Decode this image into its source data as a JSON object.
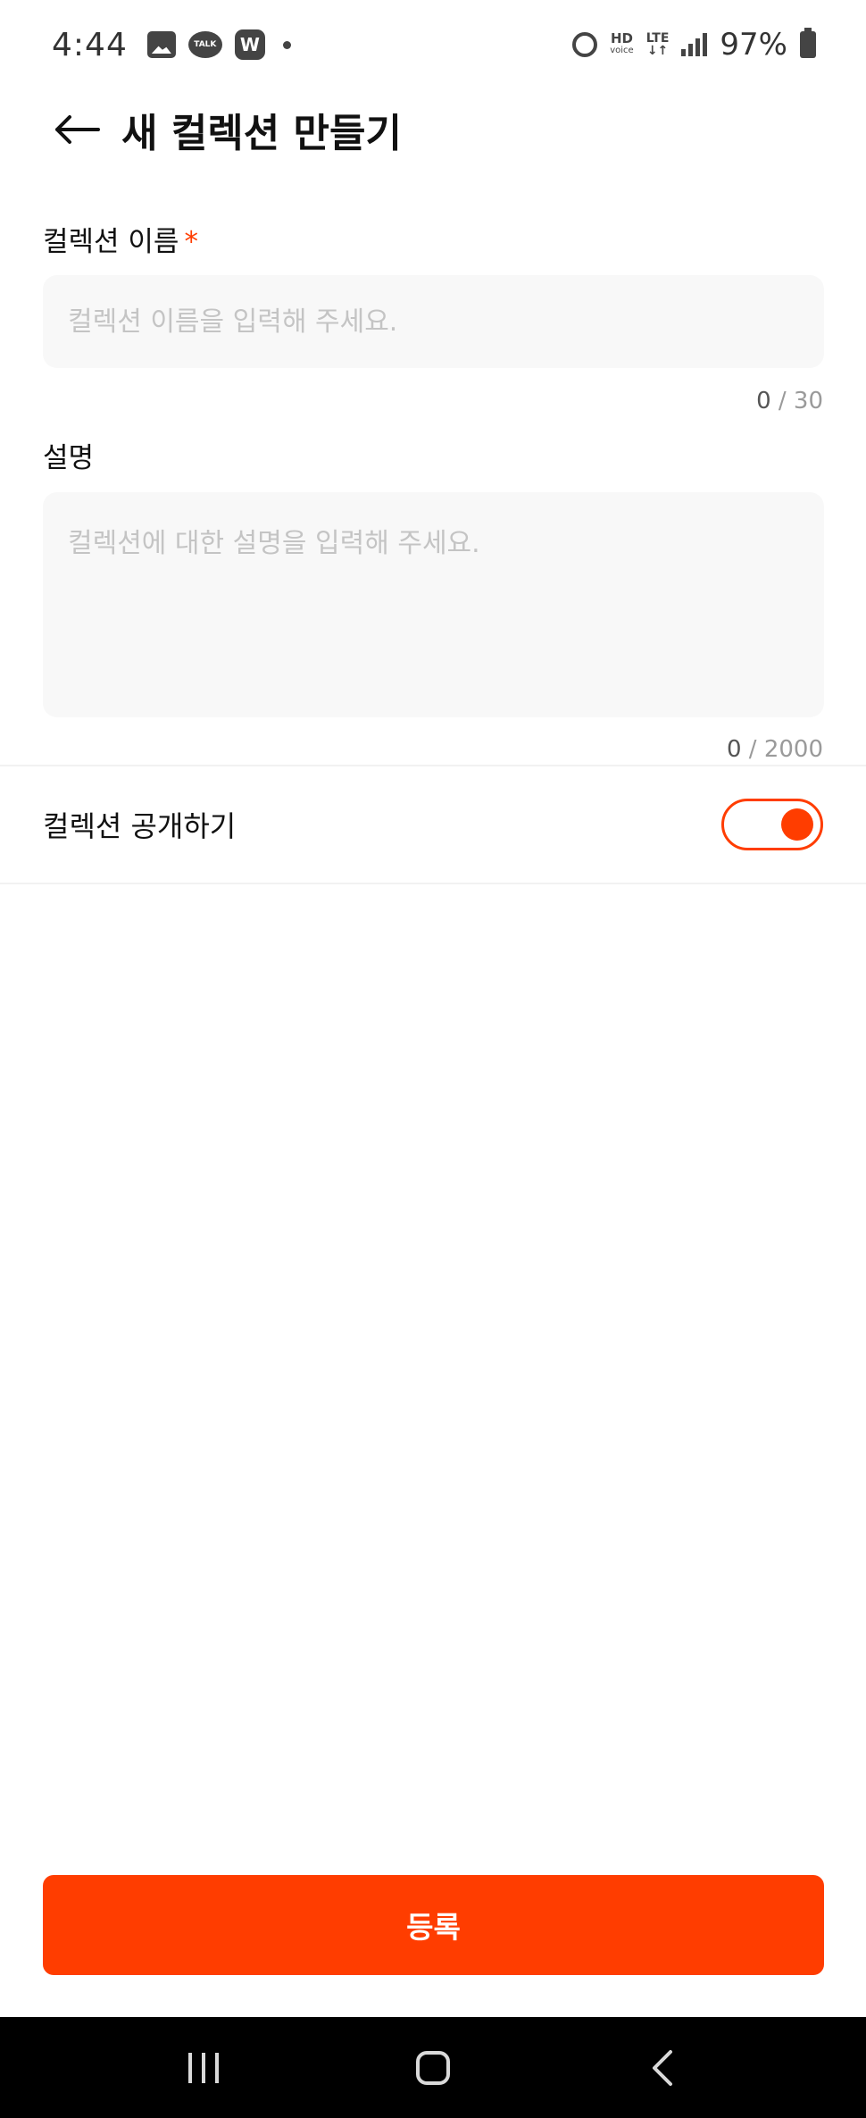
{
  "status_bar": {
    "time": "4:44",
    "icons": [
      "gallery-icon",
      "kakaotalk-icon",
      "w-app-icon",
      "notification-dot-icon",
      "alarm-icon",
      "hd-voice-icon",
      "lte-icon",
      "signal-icon",
      "battery-icon"
    ],
    "talk_label": "TALK",
    "w_label": "W",
    "hd_label": "HD",
    "voice_label": "voice",
    "lte_label": "LTE",
    "lte_arrows": "↓↑",
    "battery": "97%"
  },
  "header": {
    "title": "새 컬렉션 만들기",
    "back_icon": "arrow-left-icon"
  },
  "form": {
    "name": {
      "label": "컬렉션 이름",
      "required_mark": "*",
      "value": "",
      "placeholder": "컬렉션 이름을 입력해 주세요.",
      "count": "0",
      "max": "/ 30"
    },
    "description": {
      "label": "설명",
      "value": "",
      "placeholder": "컬렉션에 대한 설명을 입력해 주세요.",
      "count": "0",
      "max": "/ 2000"
    },
    "public_toggle": {
      "label": "컬렉션 공개하기",
      "on": true
    }
  },
  "submit": {
    "label": "등록"
  },
  "colors": {
    "accent": "#ff3d00",
    "field_bg": "#f8f8f8",
    "placeholder": "#c4c4c4",
    "nav_bg": "#000000"
  },
  "nav_bar": {
    "icons": [
      "recent-apps-icon",
      "home-icon",
      "back-icon"
    ]
  }
}
